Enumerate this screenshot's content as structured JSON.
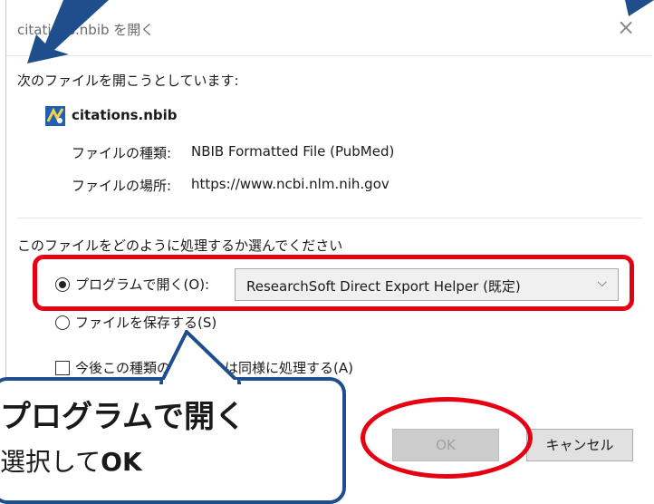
{
  "dialog": {
    "title": "citations.nbib を開く",
    "close_label": "×",
    "intro": "次のファイルを開こうとしています:",
    "file_name": "citations.nbib",
    "file_type_label": "ファイルの種類:",
    "file_type_value": "NBIB Formatted File (PubMed)",
    "file_location_label": "ファイルの場所:",
    "file_location_value": "https://www.ncbi.nlm.nih.gov",
    "question": "このファイルをどのように処理するか選んでください",
    "open_with_label": "プログラムで開く(O):",
    "open_with_selected": "ResearchSoft Direct Export Helper (既定)",
    "save_file_label": "ファイルを保存する(S)",
    "remember_label": "今後この種類のファイルは同様に処理する(A)",
    "ok_label": "OK",
    "cancel_label": "キャンセル"
  },
  "callout": {
    "line1": "プログラムで開く",
    "line2_prefix": "選択して",
    "line2_bold": "OK"
  },
  "colors": {
    "highlight_red": "#e60012",
    "arrow_blue": "#1f4e8c"
  }
}
